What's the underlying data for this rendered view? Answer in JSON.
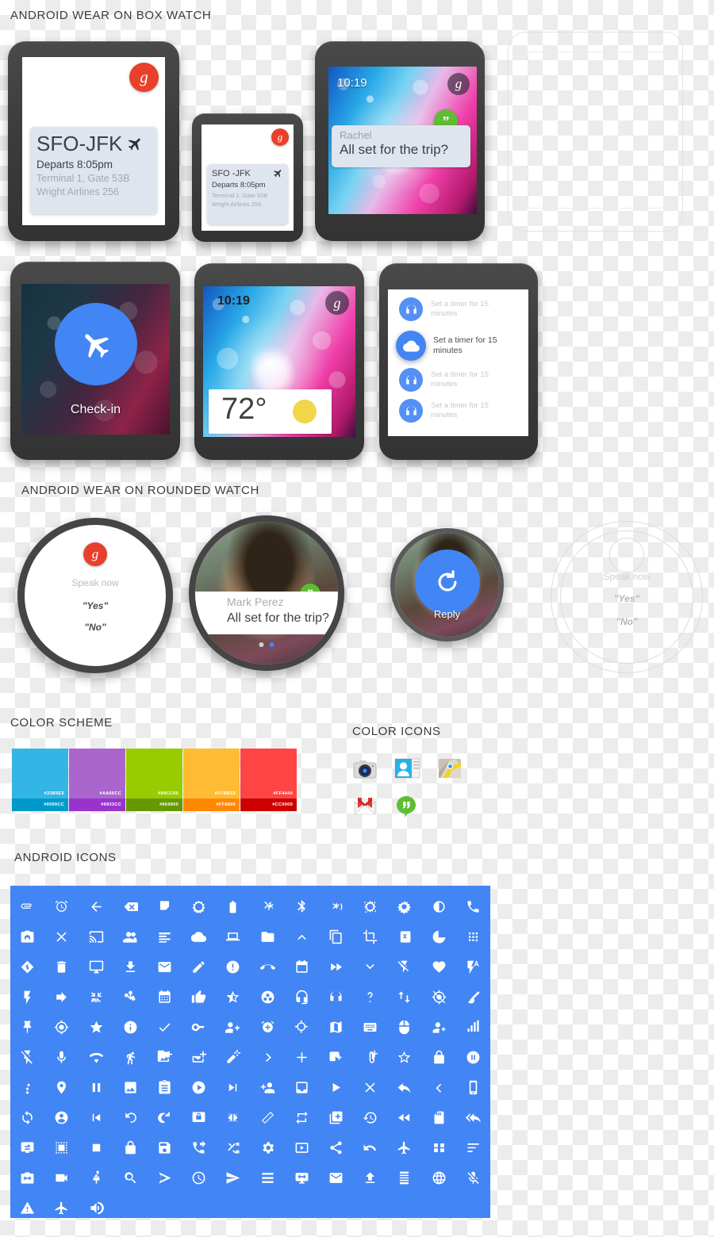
{
  "sections": {
    "box_watch_title": "ANDROID WEAR ON BOX WATCH",
    "rounded_watch_title": "ANDROID WEAR ON ROUNDED WATCH",
    "color_scheme_title": "COLOR SCHEME",
    "color_icons_title": "COLOR ICONS",
    "android_icons_title": "ANDROID ICONS"
  },
  "box_watches": [
    {
      "id": "flight-card-large",
      "badge": "g",
      "card": {
        "route": "SFO-JFK",
        "departs": "Departs 8:05pm",
        "terminal": "Terminal 1, Gate 53B",
        "airline": "Wright Airlines 256",
        "icon": "airplane-icon"
      }
    },
    {
      "id": "flight-card-small",
      "badge": "g",
      "card": {
        "route": "SFO -JFK",
        "departs": "Departs 8:05pm",
        "terminal": "Terminal 1, Gate 53B",
        "airline": "Wright Airlines 256",
        "icon": "airplane-icon"
      }
    },
    {
      "id": "hangouts-message",
      "time": "10:19",
      "badge": "g",
      "sender": "Rachel",
      "message": "All set for the trip?",
      "app_icon": "hangouts-icon"
    },
    {
      "id": "ghost-watch",
      "label": ""
    }
  ],
  "box_watches_row2": [
    {
      "id": "check-in",
      "action_label": "Check-in",
      "icon": "airplane-icon"
    },
    {
      "id": "weather",
      "time": "10:19",
      "badge": "g",
      "temperature": "72°",
      "condition_icon": "sun-icon"
    },
    {
      "id": "timer-list",
      "items": [
        {
          "icon": "headphones-icon",
          "text": "Set a timer for 15 minutes",
          "active": false
        },
        {
          "icon": "cloud-icon",
          "text": "Set a timer for 15 minutes",
          "active": true
        },
        {
          "icon": "headphones-icon",
          "text": "Set a timer for 15 minutes",
          "active": false
        },
        {
          "icon": "headphones-icon",
          "text": "Set a timer for 15 minutes",
          "active": false
        }
      ]
    }
  ],
  "round_watches": [
    {
      "id": "voice-prompt",
      "badge": "g",
      "prompt": "Speak now",
      "option_yes": "\"Yes\"",
      "option_no": "\"No\""
    },
    {
      "id": "hangouts-round",
      "sender": "Mark Perez",
      "message": "All set for the trip?",
      "app_icon": "hangouts-icon",
      "page_dots": 2,
      "active_dot": 1
    },
    {
      "id": "reply-action",
      "action_label": "Reply",
      "icon": "reply-refresh-icon"
    },
    {
      "id": "voice-prompt-ghost",
      "prompt": "Speak now",
      "option_yes": "\"Yes\"",
      "option_no": "\"No\""
    }
  ],
  "color_scheme": [
    {
      "main_hex": "#33B5E5",
      "main_label": "#33B5E5",
      "sub_hex": "#0099CC",
      "sub_label": "#0099CC"
    },
    {
      "main_hex": "#AA66CC",
      "main_label": "#AA66CC",
      "sub_hex": "#9933CC",
      "sub_label": "#9933CC"
    },
    {
      "main_hex": "#99CC00",
      "main_label": "#99CC00",
      "sub_hex": "#669900",
      "sub_label": "#669900"
    },
    {
      "main_hex": "#FFBB33",
      "main_label": "#FFBB33",
      "sub_hex": "#FF8800",
      "sub_label": "#FF8800"
    },
    {
      "main_hex": "#FF4444",
      "main_label": "#FF4444",
      "sub_hex": "#CC0000",
      "sub_label": "#CC0000"
    }
  ],
  "color_icons": [
    {
      "name": "camera-icon"
    },
    {
      "name": "contacts-icon"
    },
    {
      "name": "maps-icon"
    },
    {
      "name": "gmail-icon"
    },
    {
      "name": "hangouts-icon"
    }
  ],
  "android_icons": {
    "background": "#4285F4",
    "columns": 14,
    "names": [
      "attachment-icon",
      "alarm-icon",
      "arrow-back-icon",
      "backspace-icon",
      "flag-icon",
      "brightness-auto-icon",
      "battery-icon",
      "bluetooth-searching-icon",
      "bluetooth-icon",
      "bluetooth-audio-icon",
      "brightness-low-icon",
      "brightness-high-icon",
      "brightness-medium-icon",
      "call-icon",
      "camera-icon",
      "close-icon",
      "cast-icon",
      "group-icon",
      "subject-icon",
      "cloud-icon",
      "laptop-icon",
      "folder-icon",
      "expand-less-icon",
      "copy-icon",
      "crop-icon",
      "cut-icon",
      "pie-chart-icon",
      "dialpad-icon",
      "navigation-icon",
      "delete-icon",
      "desktop-icon",
      "download-icon",
      "email-icon",
      "edit-icon",
      "error-icon",
      "call-end-icon",
      "event-icon",
      "fast-forward-icon",
      "expand-more-icon",
      "flash-off-icon",
      "favorite-icon",
      "flash-auto-icon",
      "flash-on-icon",
      "forward-icon",
      "fullscreen-exit-icon",
      "gamepad-icon",
      "grid-calendar-icon",
      "thumb-up-icon",
      "star-half-icon",
      "group-work-icon",
      "headset-mic-icon",
      "headset-icon",
      "help-icon",
      "swap-vert-icon",
      "gps-off-icon",
      "brush-icon",
      "pin-icon",
      "gps-fixed-icon",
      "star-icon",
      "info-icon",
      "check-icon",
      "key-icon",
      "group-add-icon",
      "alarm-add-icon",
      "location-searching-icon",
      "map-icon",
      "keyboard-icon",
      "mouse-icon",
      "person-key-icon",
      "signal-cellular-icon",
      "flash-slash-icon",
      "mic-icon",
      "wifi-icon",
      "walk-icon",
      "add-photo-icon",
      "mail-add-icon",
      "edit-add-icon",
      "chevron-right-icon",
      "add-icon",
      "add-box-icon",
      "attach-add-icon",
      "star-border-icon",
      "lock-icon",
      "pause-circle-icon",
      "more-vert-icon",
      "place-icon",
      "pause-icon",
      "image-icon",
      "clipboard-icon",
      "play-circle-icon",
      "skip-next-icon",
      "person-add-icon",
      "inbox-icon",
      "play-arrow-icon",
      "clear-icon",
      "reply-icon",
      "chevron-left-icon",
      "phone-android-icon",
      "sync-icon",
      "account-circle-icon",
      "skip-previous-icon",
      "rotate-left-icon",
      "rotate-right-icon",
      "screen-lock-icon",
      "fullscreen-compress-icon",
      "screen-rotation-icon",
      "repeat-icon",
      "library-add-icon",
      "restore-icon",
      "rewind-icon",
      "sd-card-icon",
      "reply-all-icon",
      "screen-share-icon",
      "select-all-icon",
      "stop-icon",
      "lock-closed-icon",
      "save-icon",
      "phone-forwarded-icon",
      "shuffle-icon",
      "settings-icon",
      "slideshow-icon",
      "share-icon",
      "undo-icon",
      "airplane-icon",
      "apps-icon",
      "sort-icon",
      "switch-camera-icon",
      "videocam-icon",
      "usb-icon",
      "search-icon",
      "send-plane-icon",
      "clock-icon",
      "send-icon",
      "list-icon",
      "swap-screen-icon",
      "markunread-icon",
      "upload-icon",
      "reorder-icon",
      "language-icon",
      "mic-off-icon",
      "warning-icon",
      "flight-icon",
      "volume-up-icon"
    ]
  }
}
